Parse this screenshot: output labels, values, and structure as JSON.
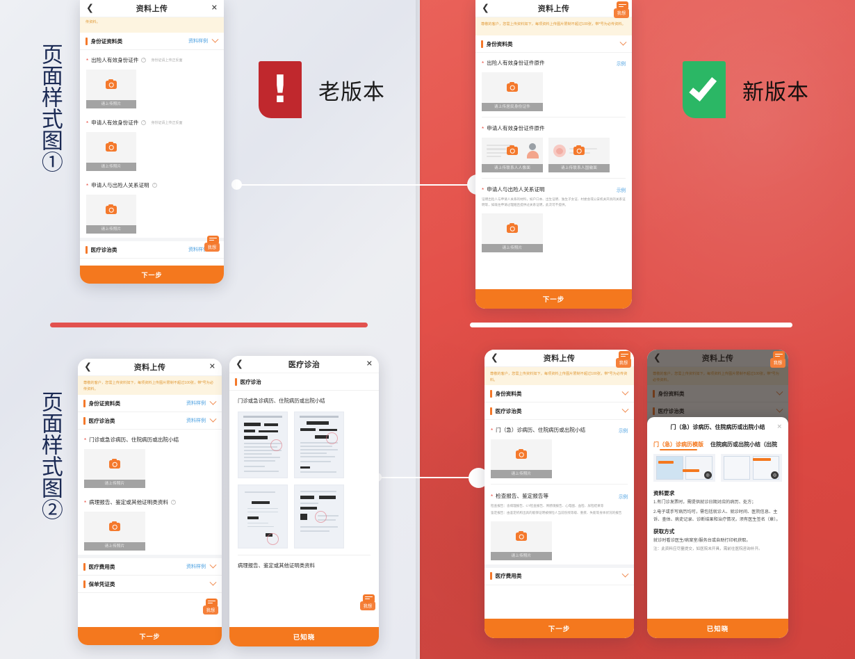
{
  "labels": {
    "figure_one": "页面样式图①",
    "figure_two": "页面样式图②"
  },
  "badges": {
    "old": {
      "glyph": "!",
      "text": "老版本",
      "color": "#c0282d"
    },
    "new": {
      "glyph": "✔",
      "text": "新版本",
      "color": "#2bb765"
    }
  },
  "common": {
    "nav_title": "资料上传",
    "nav_back_icon": "chevron-left-icon",
    "nav_close_icon": "close-icon",
    "notice": "尊敬的客户，您需上传资料如下，每项资料上传图片限制不超过100张，带*号为必传资料。",
    "notice_tail": "100张，带*号为必传资料。",
    "sample_link": "资料样例",
    "example_link": "示例",
    "upload_photo": "请上传照片",
    "next_button": "下一步",
    "known_button": "已知晓",
    "chat_label": "我想",
    "chat_icon": "chat-bubble-icon",
    "camera_icon": "camera-icon",
    "chevron_icon": "chevron-down-icon",
    "help_icon": "question-mark-icon"
  },
  "phone1": {
    "sections": [
      {
        "title": "身份证资料类",
        "sample": "资料样例"
      },
      {
        "title": "医疗诊治类",
        "sample": "资料样例"
      }
    ],
    "fields": [
      {
        "label": "出险人有效身份证件",
        "hint": "身份证请上传正反面",
        "required": true,
        "upload": "请上传照片"
      },
      {
        "label": "申请人有效身份证件",
        "hint": "身份证请上传正反面",
        "required": true,
        "upload": "请上传照片"
      },
      {
        "label": "申请人与出险人关系证明",
        "hint": "",
        "required": true,
        "upload": "请上传照片"
      }
    ],
    "cta": "下一步"
  },
  "phone2": {
    "section": {
      "title": "身份资料类"
    },
    "fields": [
      {
        "label": "出险人有效身份证件原件",
        "required": true,
        "sample": "示例",
        "upload_caption": "请上传居民身份证件"
      },
      {
        "label": "申请人有效身份证件原件",
        "required": true,
        "sample": "",
        "uploads": [
          "请上传联系人人像面",
          "请上传联系人国徽面"
        ]
      },
      {
        "label": "申请人与出险人关系证明",
        "required": true,
        "sample": "示例",
        "desc": "证明出险人与申请人关系的材料，如户口本、出生证明、独生子女证、村委会或公安机关开具的关系证明等，如既往申请过理赔且提供过关系证明，此次可不提供。",
        "upload_caption": "请上传照片"
      }
    ],
    "cta": "下一步"
  },
  "phone3": {
    "sections": [
      {
        "title": "身份证资料类",
        "sample": "资料样例"
      },
      {
        "title": "医疗诊治类",
        "sample": "资料样例"
      },
      {
        "title": "医疗费用类",
        "sample": "资料样例"
      },
      {
        "title": "保单凭证类",
        "sample": ""
      }
    ],
    "fields": [
      {
        "label": "门诊或急诊病历、住院病历或出院小结",
        "required": true,
        "upload": "请上传照片"
      },
      {
        "label": "病理报告、鉴定或其他证明类资料",
        "required": true,
        "upload": "请上传照片"
      }
    ],
    "cta": "下一步"
  },
  "phone4": {
    "nav_title": "医疗诊治",
    "section_title": "医疗诊治",
    "group_one": "门诊或急诊病历、住院病历或出院小结",
    "group_two": "病理报告、鉴定或其他证明类资料",
    "cta": "已知晓"
  },
  "phone5": {
    "sections": [
      {
        "title": "身份资料类"
      },
      {
        "title": "医疗诊治类"
      },
      {
        "title": "医疗费用类"
      }
    ],
    "fields": [
      {
        "label": "门（急）诊病历、住院病历或出院小结",
        "required": true,
        "sample": "示例",
        "upload": "请上传照片"
      },
      {
        "label": "检查报告、鉴定报告等",
        "required": true,
        "sample": "示例",
        "desc_1": "检查报告：含病理报告、CT检查报告、胃肠镜报告、心电图、血检、尿检结果等",
        "desc_2": "鉴定报告：由鉴定机构出具的能够证明被保险人当前伤残等级、重疾、失能等身体状况的报告",
        "upload": "请上传照片"
      }
    ],
    "cta": "下一步"
  },
  "phone6": {
    "sections": [
      {
        "title": "身份资料类"
      },
      {
        "title": "医疗诊治类"
      }
    ],
    "field_label": "门（急）诊病历、住院病历或出院小结",
    "field_sample": "示例",
    "sheet": {
      "title": "门（急）诊病历、住院病历或出院小结",
      "close_icon": "close-icon",
      "tabs": [
        {
          "label": "门（急）诊病历模版",
          "active": true
        },
        {
          "label": "住院病历或出院小结（出院",
          "active": false
        }
      ],
      "req_heading": "资料要求",
      "req_items": [
        "1.有门诊发票时，需提供就诊日期对应的病历、处方；",
        "2.电子或手写病历均可，需包括就诊人、就诊时间、医院信息、主诉、查体、病史记录、诊断结果和治疗情况，须有医生签名（章）。"
      ],
      "get_heading": "获取方式",
      "get_text": "就诊时看诊医生/病案室/服务台或自助打印机获取。",
      "get_note": "注：此资料应尽量提交，如医院未开具，需前往医院咨询补开。",
      "cta": "已知晓"
    }
  },
  "colors": {
    "brand_orange": "#f4781e",
    "accent_red": "#e2514e",
    "right_pane": "#e0504a",
    "link_blue": "#4a9fe0",
    "notice_bg": "#fdf4e0",
    "notice_text": "#e09a38",
    "label_navy": "#1b2a54"
  }
}
